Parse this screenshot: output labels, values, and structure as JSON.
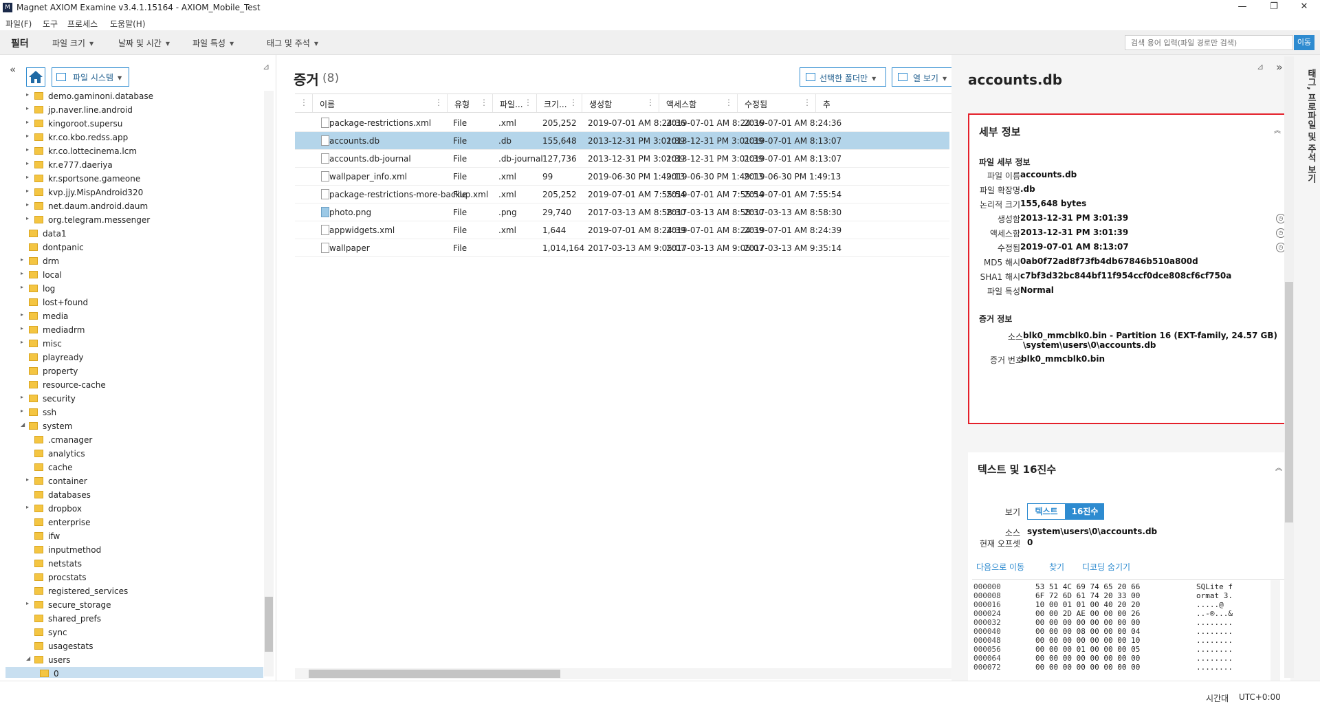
{
  "window": {
    "title": "Magnet AXIOM Examine v3.4.1.15164 - AXIOM_Mobile_Test",
    "min": "—",
    "max": "❐",
    "close": "✕"
  },
  "menu": [
    "파일(F)",
    "도구",
    "프로세스",
    "도움말(H)"
  ],
  "filterbar": {
    "title": "필터",
    "dropdowns": [
      "파일 크기",
      "날짜 및 시간",
      "파일 특성",
      "태그 및 주석"
    ],
    "search_placeholder": "검색 용어 입력(파일 경로만 검색)",
    "search_go": "이동"
  },
  "leftpanel": {
    "collapse": "«",
    "fs_dropdown": "파일 시스템",
    "pin": "⊿",
    "tree": [
      {
        "label": "demo.gaminoni.database",
        "level": 1,
        "exp": "▸"
      },
      {
        "label": "jp.naver.line.android",
        "level": 1,
        "exp": "▸"
      },
      {
        "label": "kingoroot.supersu",
        "level": 1,
        "exp": "▸"
      },
      {
        "label": "kr.co.kbo.redss.app",
        "level": 1,
        "exp": "▸"
      },
      {
        "label": "kr.co.lottecinema.lcm",
        "level": 1,
        "exp": "▸"
      },
      {
        "label": "kr.e777.daeriya",
        "level": 1,
        "exp": "▸"
      },
      {
        "label": "kr.sportsone.gameone",
        "level": 1,
        "exp": "▸"
      },
      {
        "label": "kvp.jjy.MispAndroid320",
        "level": 1,
        "exp": "▸"
      },
      {
        "label": "net.daum.android.daum",
        "level": 1,
        "exp": "▸"
      },
      {
        "label": "org.telegram.messenger",
        "level": 1,
        "exp": "▸"
      },
      {
        "label": "data1",
        "level": 0,
        "exp": ""
      },
      {
        "label": "dontpanic",
        "level": 0,
        "exp": ""
      },
      {
        "label": "drm",
        "level": 0,
        "exp": "▸"
      },
      {
        "label": "local",
        "level": 0,
        "exp": "▸"
      },
      {
        "label": "log",
        "level": 0,
        "exp": "▸"
      },
      {
        "label": "lost+found",
        "level": 0,
        "exp": ""
      },
      {
        "label": "media",
        "level": 0,
        "exp": "▸"
      },
      {
        "label": "mediadrm",
        "level": 0,
        "exp": "▸"
      },
      {
        "label": "misc",
        "level": 0,
        "exp": "▸"
      },
      {
        "label": "playready",
        "level": 0,
        "exp": ""
      },
      {
        "label": "property",
        "level": 0,
        "exp": ""
      },
      {
        "label": "resource-cache",
        "level": 0,
        "exp": ""
      },
      {
        "label": "security",
        "level": 0,
        "exp": "▸"
      },
      {
        "label": "ssh",
        "level": 0,
        "exp": "▸"
      },
      {
        "label": "system",
        "level": 0,
        "exp": "◢"
      },
      {
        "label": ".cmanager",
        "level": 1,
        "exp": ""
      },
      {
        "label": "analytics",
        "level": 1,
        "exp": ""
      },
      {
        "label": "cache",
        "level": 1,
        "exp": ""
      },
      {
        "label": "container",
        "level": 1,
        "exp": "▸"
      },
      {
        "label": "databases",
        "level": 1,
        "exp": ""
      },
      {
        "label": "dropbox",
        "level": 1,
        "exp": "▸"
      },
      {
        "label": "enterprise",
        "level": 1,
        "exp": ""
      },
      {
        "label": "ifw",
        "level": 1,
        "exp": ""
      },
      {
        "label": "inputmethod",
        "level": 1,
        "exp": ""
      },
      {
        "label": "netstats",
        "level": 1,
        "exp": ""
      },
      {
        "label": "procstats",
        "level": 1,
        "exp": ""
      },
      {
        "label": "registered_services",
        "level": 1,
        "exp": ""
      },
      {
        "label": "secure_storage",
        "level": 1,
        "exp": "▸"
      },
      {
        "label": "shared_prefs",
        "level": 1,
        "exp": ""
      },
      {
        "label": "sync",
        "level": 1,
        "exp": ""
      },
      {
        "label": "usagestats",
        "level": 1,
        "exp": ""
      },
      {
        "label": "users",
        "level": 1,
        "exp": "◢"
      },
      {
        "label": "0",
        "level": 2,
        "exp": "",
        "selected": true
      }
    ]
  },
  "evidence": {
    "title": "증거",
    "count": "(8)",
    "selected_folder_btn": "선택한 폴더만",
    "columns_btn": "열 보기",
    "columns": [
      "이름",
      "유형",
      "파일...",
      "크기...",
      "생성함",
      "액세스함",
      "수정됨",
      "추"
    ],
    "rows": [
      {
        "name": "package-restrictions.xml",
        "type": "File",
        "ext": ".xml",
        "size": "205,252",
        "created": "2019-07-01 AM 8:24:36",
        "accessed": "2019-07-01 AM 8:24:36",
        "modified": "2019-07-01 AM 8:24:36",
        "icon": "file-icon"
      },
      {
        "name": "accounts.db",
        "type": "File",
        "ext": ".db",
        "size": "155,648",
        "created": "2013-12-31 PM 3:01:39",
        "accessed": "2013-12-31 PM 3:01:39",
        "modified": "2019-07-01 AM 8:13:07",
        "icon": "db-file-icon",
        "selected": true
      },
      {
        "name": "accounts.db-journal",
        "type": "File",
        "ext": ".db-journal",
        "size": "127,736",
        "created": "2013-12-31 PM 3:01:39",
        "accessed": "2013-12-31 PM 3:01:39",
        "modified": "2019-07-01 AM 8:13:07",
        "icon": "file-icon"
      },
      {
        "name": "wallpaper_info.xml",
        "type": "File",
        "ext": ".xml",
        "size": "99",
        "created": "2019-06-30 PM 1:49:13",
        "accessed": "2019-06-30 PM 1:49:13",
        "modified": "2019-06-30 PM 1:49:13",
        "icon": "file-icon"
      },
      {
        "name": "package-restrictions-more-backup.xml",
        "type": "File",
        "ext": ".xml",
        "size": "205,252",
        "created": "2019-07-01 AM 7:55:54",
        "accessed": "2019-07-01 AM 7:55:54",
        "modified": "2019-07-01 AM 7:55:54",
        "icon": "file-icon"
      },
      {
        "name": "photo.png",
        "type": "File",
        "ext": ".png",
        "size": "29,740",
        "created": "2017-03-13 AM 8:58:30",
        "accessed": "2017-03-13 AM 8:58:30",
        "modified": "2017-03-13 AM 8:58:30",
        "icon": "image-file-icon"
      },
      {
        "name": "appwidgets.xml",
        "type": "File",
        "ext": ".xml",
        "size": "1,644",
        "created": "2019-07-01 AM 8:24:39",
        "accessed": "2019-07-01 AM 8:24:39",
        "modified": "2019-07-01 AM 8:24:39",
        "icon": "file-icon"
      },
      {
        "name": "wallpaper",
        "type": "File",
        "ext": "",
        "size": "1,014,164",
        "created": "2017-03-13 AM 9:05:07",
        "accessed": "2017-03-13 AM 9:05:07",
        "modified": "2017-03-13 AM 9:35:14",
        "icon": "file-icon"
      }
    ]
  },
  "details": {
    "title": "accounts.db",
    "pin": "⊿",
    "expand": "»",
    "vertical_tab": "태그, 프로파일 및 주석 보기",
    "card_title": "세부 정보",
    "collapse": "︽",
    "file_section": "파일 세부 정보",
    "file_fields": [
      {
        "k": "파일 이름",
        "v": "accounts.db"
      },
      {
        "k": "파일 확장명",
        "v": ".db"
      },
      {
        "k": "논리적 크기",
        "v": "155,648 bytes"
      },
      {
        "k": "생성함",
        "v": "2013-12-31 PM 3:01:39",
        "clock": true
      },
      {
        "k": "액세스함",
        "v": "2013-12-31 PM 3:01:39",
        "clock": true
      },
      {
        "k": "수정됨",
        "v": "2019-07-01 AM 8:13:07",
        "clock": true
      },
      {
        "k": "MD5 해시",
        "v": "0ab0f72ad8f73fb4db67846b510a800d"
      },
      {
        "k": "SHA1 해시",
        "v": "c7bf3d32bc844bf11f954ccf0dce808cf6cf750a"
      },
      {
        "k": "파일 특성",
        "v": "Normal"
      }
    ],
    "evidence_section": "증거 정보",
    "source_label": "소스",
    "source_line1": "blk0_mmcblk0.bin - Partition 16 (EXT-family, 24.57 GB)",
    "source_line2": "\\system\\users\\0\\accounts.db",
    "evidence_no_label": "증거 번호",
    "evidence_no": "blk0_mmcblk0.bin"
  },
  "hex": {
    "title": "텍스트 및 16진수",
    "collapse": "︽",
    "view_label": "보기",
    "tab_text": "텍스트",
    "tab_hex": "16진수",
    "source_label": "소스",
    "source_value": "system\\users\\0\\accounts.db",
    "offset_label": "현재 오프셋",
    "offset_value": "0",
    "links": [
      "다음으로 이동",
      "찾기",
      "디코딩 숨기기"
    ],
    "rows": [
      {
        "off": "000000",
        "bytes": "53 51 4C 69 74 65 20 66",
        "ascii": "SQLite f"
      },
      {
        "off": "000008",
        "bytes": "6F 72 6D 61 74 20 33 00",
        "ascii": "ormat 3."
      },
      {
        "off": "000016",
        "bytes": "10 00 01 01 00 40 20 20",
        "ascii": ".....@  "
      },
      {
        "off": "000024",
        "bytes": "00 00 2D AE 00 00 00 26",
        "ascii": "..-®...&"
      },
      {
        "off": "000032",
        "bytes": "00 00 00 00 00 00 00 00",
        "ascii": "........"
      },
      {
        "off": "000040",
        "bytes": "00 00 00 08 00 00 00 04",
        "ascii": "........"
      },
      {
        "off": "000048",
        "bytes": "00 00 00 00 00 00 00 10",
        "ascii": "........"
      },
      {
        "off": "000056",
        "bytes": "00 00 00 01 00 00 00 05",
        "ascii": "........"
      },
      {
        "off": "000064",
        "bytes": "00 00 00 00 00 00 00 00",
        "ascii": "........"
      },
      {
        "off": "000072",
        "bytes": "00 00 00 00 00 00 00 00",
        "ascii": "........"
      }
    ]
  },
  "status": {
    "timezone_label": "시간대",
    "timezone_value": "UTC+0:00"
  },
  "colors": {
    "accent": "#2e8bd0",
    "selection": "#b4d5ea",
    "highlight_border": "#e4202a",
    "folder": "#f4c542"
  }
}
